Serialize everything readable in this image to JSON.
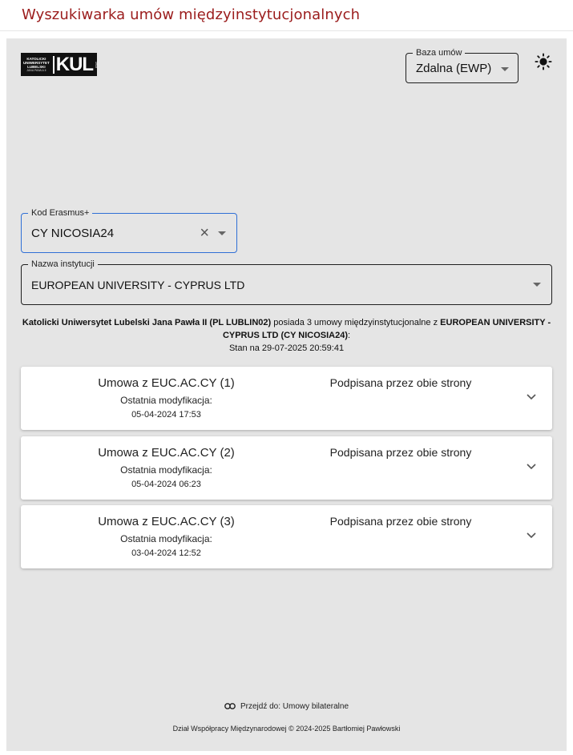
{
  "header": {
    "title": "Wyszukiwarka umów międzyinstytucjonalnych"
  },
  "logo": {
    "lines": [
      "KATOLICKI",
      "UNIWERSYTET",
      "LUBELSKI"
    ],
    "sub": "JANA PAWŁA II",
    "mark": "KUL",
    "tag": "1918"
  },
  "baza": {
    "label": "Baza umów",
    "value": "Zdalna (EWP)"
  },
  "theme_toggle": {
    "icon": "sun-icon"
  },
  "kod": {
    "label": "Kod Erasmus+",
    "value": "CY NICOSIA24"
  },
  "nazwa": {
    "label": "Nazwa instytucji",
    "value": "EUROPEAN UNIVERSITY - CYPRUS LTD"
  },
  "summary": {
    "home_inst": "Katolicki Uniwersytet Lubelski Jana Pawła II (PL LUBLIN02)",
    "middle": " posiada 3 umowy międzyinstytucjonalne z ",
    "partner": "EUROPEAN UNIVERSITY - CYPRUS LTD (CY NICOSIA24)",
    "end": ":",
    "stan": "Stan na 29-07-2025 20:59:41"
  },
  "agreements": [
    {
      "name": "Umowa z EUC.AC.CY (1)",
      "mod_label": "Ostatnia modyfikacja:",
      "mod_date": "05-04-2024 17:53",
      "status": "Podpisana przez obie strony"
    },
    {
      "name": "Umowa z EUC.AC.CY (2)",
      "mod_label": "Ostatnia modyfikacja:",
      "mod_date": "05-04-2024 06:23",
      "status": "Podpisana przez obie strony"
    },
    {
      "name": "Umowa z EUC.AC.CY (3)",
      "mod_label": "Ostatnia modyfikacja:",
      "mod_date": "03-04-2024 12:52",
      "status": "Podpisana przez obie strony"
    }
  ],
  "footer": {
    "link_text": "Przejdź do: Umowy bilateralne",
    "copyright": "Dział Współpracy Międzynarodowej © 2024-2025 Bartłomiej Pawłowski"
  },
  "colors": {
    "title": "#9b1c1c",
    "focus": "#2f6fd6",
    "panel": "#e5e5e5"
  }
}
